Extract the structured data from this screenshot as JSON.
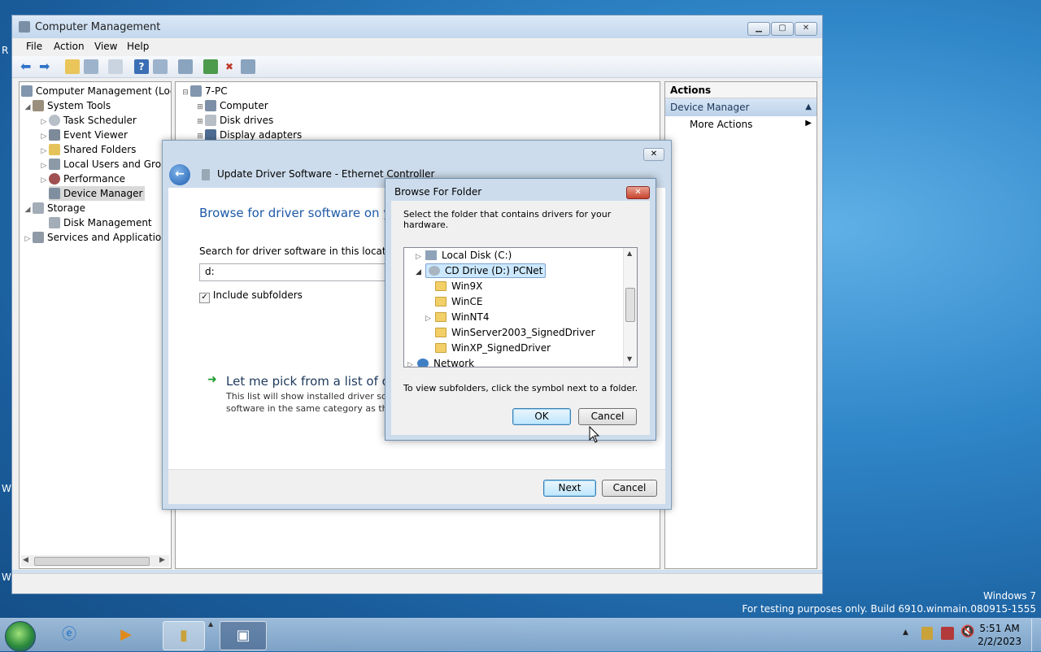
{
  "desktop": {
    "watermark_line1": "Windows 7",
    "watermark_line2": "For testing purposes only. Build 6910.winmain.080915-1555"
  },
  "window": {
    "title": "Computer Management",
    "menu": [
      "File",
      "Action",
      "View",
      "Help"
    ]
  },
  "tree": {
    "root": "Computer Management (Local",
    "system_tools": "System Tools",
    "task_scheduler": "Task Scheduler",
    "event_viewer": "Event Viewer",
    "shared_folders": "Shared Folders",
    "local_users": "Local Users and Group",
    "performance": "Performance",
    "device_manager": "Device Manager",
    "storage": "Storage",
    "disk_management": "Disk Management",
    "services": "Services and Applications"
  },
  "devices": {
    "computer_name": "7-PC",
    "items": [
      "Computer",
      "Disk drives",
      "Display adapters"
    ]
  },
  "actions": {
    "header": "Actions",
    "section": "Device Manager",
    "more_actions": "More Actions"
  },
  "wizard": {
    "title": "Update Driver Software - Ethernet Controller",
    "heading": "Browse for driver software on yo",
    "search_label": "Search for driver software in this location:",
    "path_value": "d:",
    "include_subfolders": "Include subfolders",
    "pick_link": "Let me pick from a list of dev",
    "pick_desc_line1": "This list will show installed driver soft",
    "pick_desc_line2": "software in the same category as the",
    "next": "Next",
    "cancel": "Cancel"
  },
  "browse": {
    "title": "Browse For Folder",
    "instruction": "Select the folder that contains drivers for your hardware.",
    "local_disk": "Local Disk (C:)",
    "cd_drive": "CD Drive (D:) PCNet",
    "folders": [
      "Win9X",
      "WinCE",
      "WinNT4",
      "WinServer2003_SignedDriver",
      "WinXP_SignedDriver"
    ],
    "network": "Network",
    "hint": "To view subfolders, click the symbol next to a folder.",
    "ok": "OK",
    "cancel": "Cancel"
  },
  "taskbar": {
    "time": "5:51 AM",
    "date": "2/2/2023"
  },
  "colors": {
    "accent": "#3c7fb1",
    "selection": "#cce8ff",
    "link_green": "#1a9c2a",
    "heading_blue": "#1e5aa8"
  }
}
